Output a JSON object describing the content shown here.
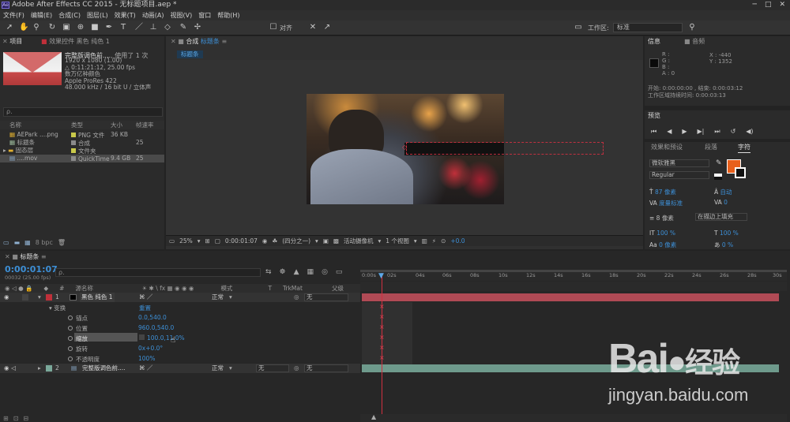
{
  "app": {
    "title": "Adobe After Effects CC 2015 - 无标题项目.aep *",
    "icon": "Ae"
  },
  "menu": [
    "文件(F)",
    "编辑(E)",
    "合成(C)",
    "图层(L)",
    "效果(T)",
    "动画(A)",
    "视图(V)",
    "窗口",
    "帮助(H)"
  ],
  "toolbar": {
    "align_label": "对齐",
    "workspace_label": "工作区:",
    "workspace_value": "标准"
  },
  "project": {
    "tab": "项目",
    "effects_tab": "效果控件 黑色 纯色 1",
    "item_name": "完整版调色前....",
    "item_used": ", 使用了 1 次",
    "info": [
      "1920 x 1080 (1.00)",
      "△ 0:11:21:12, 25.00 fps",
      "数万亿种颜色",
      "Apple ProRes 422",
      "48.000 kHz / 16 bit U / 立体声"
    ],
    "search_placeholder": "ρ.",
    "headers": [
      "名称",
      "类型",
      "大小",
      "帧速率"
    ],
    "rows": [
      {
        "name": "AEPark ....png",
        "type": "PNG 文件",
        "size": "36 KB",
        "fps": "",
        "color": "#c9c94a"
      },
      {
        "name": "标题条",
        "type": "合成",
        "size": "",
        "fps": "25",
        "color": "#8a8a8a"
      },
      {
        "name": "固态层",
        "type": "文件夹",
        "size": "",
        "fps": "",
        "color": "#c9c94a"
      },
      {
        "name": "....mov",
        "type": "QuickTime",
        "size": "9.4 GB",
        "fps": "25",
        "color": "#8a8a8a"
      }
    ],
    "bpc": "8 bpc"
  },
  "comp": {
    "tab": "合成",
    "tab_name": "标题条",
    "crumb": "标题条",
    "zoom": "25%",
    "time": "0:00:01:07",
    "res": "(四分之一)",
    "camera": "活动摄像机",
    "views": "1 个视图",
    "offset": "+0.0"
  },
  "info_panel": {
    "tab": "信息",
    "audio_tab": "音频",
    "rgba": [
      "R :",
      "G :",
      "B :",
      "A : 0"
    ],
    "x": "X : -440",
    "y": "Y : 1352",
    "line1": "开始: 0:00:00:00 , 结束: 0:00:03:12",
    "line2": "工作区域持续时间: 0:00:03:13"
  },
  "preview": {
    "tab": "预览"
  },
  "character": {
    "tabs": [
      "效果和预设",
      "段落",
      "字符"
    ],
    "font": "微软雅黑",
    "style": "Regular",
    "size": "87 像素",
    "leading": "自动",
    "kerning": "度量标准",
    "tracking": "0",
    "stroke_width": "8 像素",
    "stroke_mode": "在描边上填充",
    "v_scale": "100 %",
    "h_scale": "100 %",
    "baseline": "0 像素",
    "tsume": "0 %",
    "fill_color": "#e8601c"
  },
  "timeline": {
    "tab": "标题条",
    "timecode": "0:00:01:07",
    "frames": "00032 (25.00 fps)",
    "headers": [
      "#",
      "源名称",
      "模式",
      "T",
      "TrkMat",
      "父级"
    ],
    "ruler": [
      "0:00s",
      "02s",
      "04s",
      "06s",
      "08s",
      "10s",
      "12s",
      "14s",
      "16s",
      "18s",
      "20s",
      "22s",
      "24s",
      "26s",
      "28s",
      "30s"
    ],
    "layers": [
      {
        "num": "1",
        "name": "黑色 纯色 1",
        "mode": "正常",
        "parent": "无",
        "color": "#c0303a"
      },
      {
        "num": "2",
        "name": "完整版调色前....",
        "mode": "正常",
        "trkmat": "无",
        "parent": "无",
        "color": "#7aa89a"
      }
    ],
    "transform": "变换",
    "reset": "重置",
    "props": [
      {
        "name": "锚点",
        "value": "0.0,540.0"
      },
      {
        "name": "位置",
        "value": "960.0,540.0"
      },
      {
        "name": "缩放",
        "value": "100.0,11.0%"
      },
      {
        "name": "旋转",
        "value": "0x+0.0°"
      },
      {
        "name": "不透明度",
        "value": "100%"
      }
    ]
  },
  "watermark": {
    "brand": "Bai",
    "brand2": "经验",
    "url": "jingyan.baidu.com"
  }
}
